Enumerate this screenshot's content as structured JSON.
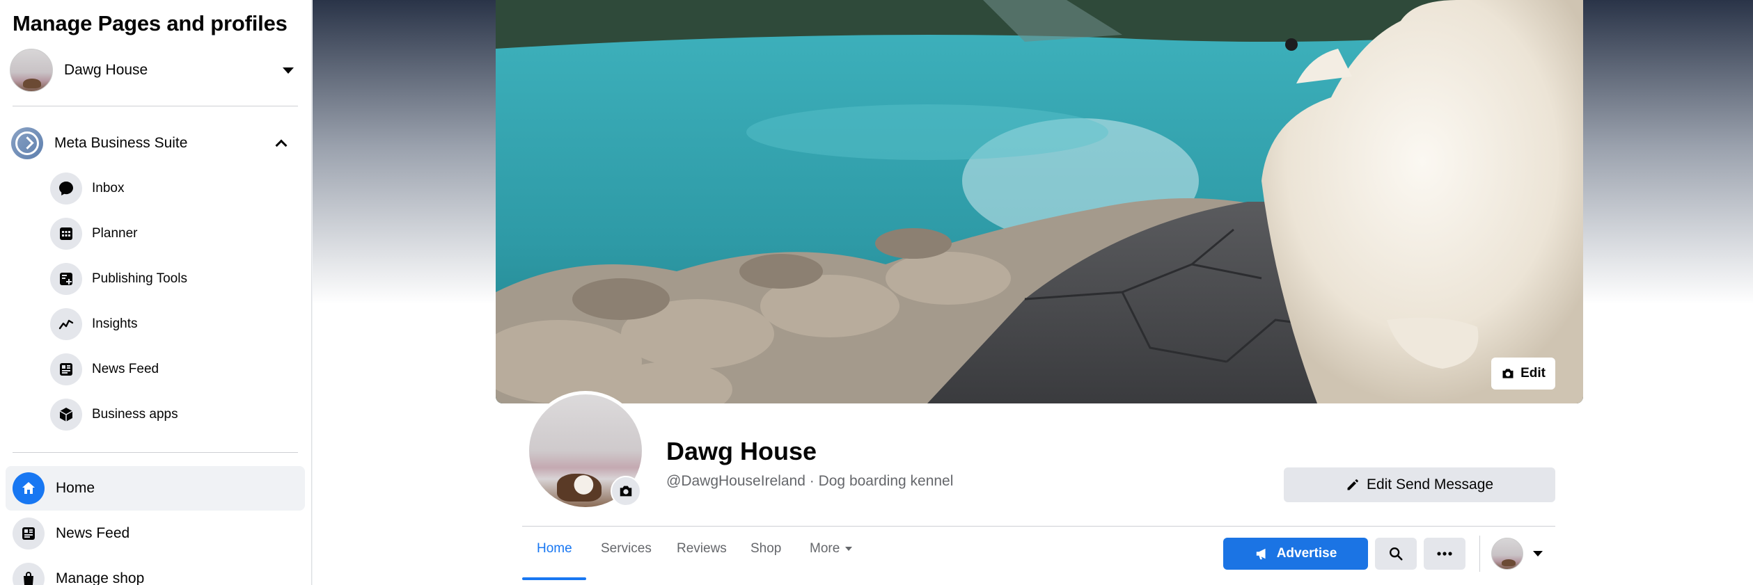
{
  "sidebar": {
    "title": "Manage Pages and profiles",
    "profile_name": "Dawg House",
    "meta_business_suite": "Meta Business Suite",
    "sub_items": [
      {
        "label": "Inbox",
        "icon": "chat-bubble-icon"
      },
      {
        "label": "Planner",
        "icon": "calendar-grid-icon"
      },
      {
        "label": "Publishing Tools",
        "icon": "publishing-tools-icon"
      },
      {
        "label": "Insights",
        "icon": "insights-trend-icon"
      },
      {
        "label": "News Feed",
        "icon": "news-feed-icon"
      },
      {
        "label": "Business apps",
        "icon": "cube-icon"
      }
    ],
    "nav_items": [
      {
        "label": "Home",
        "icon": "home-icon",
        "active": true
      },
      {
        "label": "News Feed",
        "icon": "news-feed-icon"
      },
      {
        "label": "Manage shop",
        "icon": "shopping-bag-icon"
      }
    ]
  },
  "page": {
    "cover_edit_label": "Edit",
    "name": "Dawg House",
    "subtitle": "@DawgHouseIreland · Dog boarding kennel",
    "edit_send_message_label": "Edit Send Message",
    "tabs": [
      {
        "label": "Home",
        "active": true
      },
      {
        "label": "Services"
      },
      {
        "label": "Reviews"
      },
      {
        "label": "Shop"
      },
      {
        "label": "More"
      }
    ],
    "advertise_label": "Advertise",
    "search_icon": "search-icon",
    "more_icon": "ellipsis-icon"
  },
  "colors": {
    "accent": "#1877f2",
    "button_grey": "#e4e6eb",
    "text_secondary": "#65676b"
  }
}
